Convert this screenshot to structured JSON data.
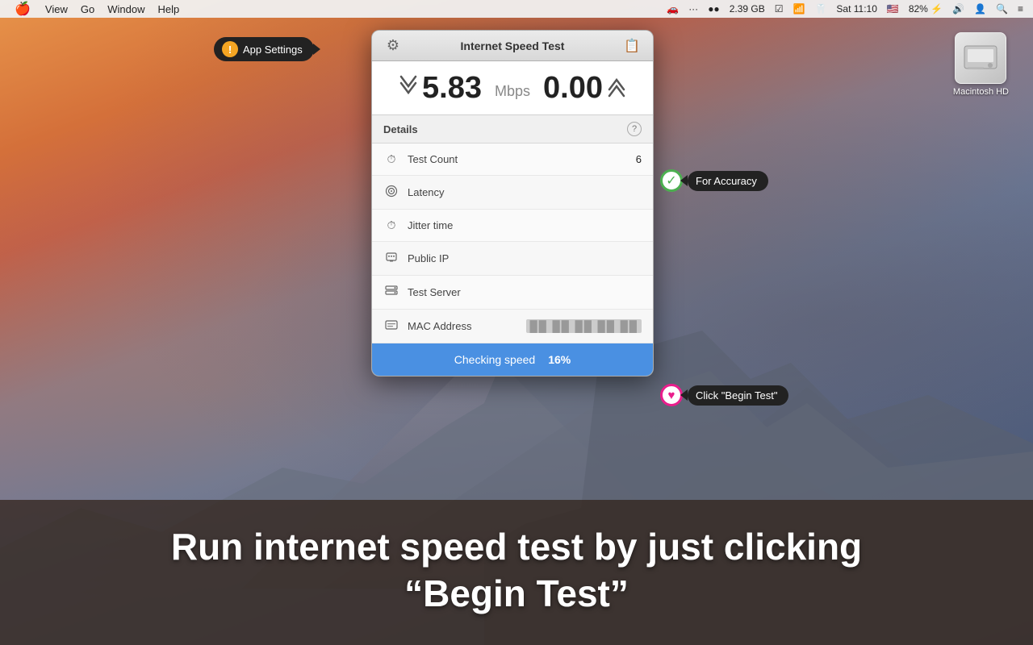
{
  "menubar": {
    "apple": "🍎",
    "items": [
      "View",
      "Go",
      "Window",
      "Help"
    ],
    "right_items": [
      {
        "label": "🚗",
        "name": "car-icon"
      },
      {
        "label": "⋯",
        "name": "dots-icon"
      },
      {
        "label": "●●",
        "name": "battery-dots"
      },
      {
        "label": "2.39 GB",
        "name": "memory-label"
      },
      {
        "label": "☑",
        "name": "clock-icon"
      },
      {
        "label": "WiFi",
        "name": "wifi-icon"
      },
      {
        "label": "BT",
        "name": "bluetooth-icon"
      },
      {
        "label": "Sat 11:10",
        "name": "time-label"
      },
      {
        "label": "🇺🇸",
        "name": "flag-icon"
      },
      {
        "label": "82% ⚡",
        "name": "battery-label"
      },
      {
        "label": "🔊",
        "name": "volume-icon"
      },
      {
        "label": "👤",
        "name": "user-icon"
      },
      {
        "label": "🔍",
        "name": "search-icon"
      },
      {
        "label": "≡",
        "name": "list-icon"
      }
    ]
  },
  "desktop": {
    "hd_icon": {
      "emoji": "💾",
      "label": "Macintosh HD"
    }
  },
  "app_panel": {
    "title": "Internet Speed Test",
    "settings_icon": "⚙",
    "share_icon": "📋",
    "speed": {
      "down_arrows": "≫",
      "down_value": "5.83",
      "unit": "Mbps",
      "up_value": "0.00",
      "up_arrows": "≪"
    },
    "details": {
      "title": "Details",
      "help": "?",
      "rows": [
        {
          "icon": "⏱",
          "label": "Test Count",
          "value": "6",
          "blurred": false,
          "name": "test-count-row"
        },
        {
          "icon": "🔄",
          "label": "Latency",
          "value": "",
          "blurred": false,
          "name": "latency-row"
        },
        {
          "icon": "⏰",
          "label": "Jitter time",
          "value": "",
          "blurred": false,
          "name": "jitter-row"
        },
        {
          "icon": "🌐",
          "label": "Public IP",
          "value": "",
          "blurred": false,
          "name": "public-ip-row"
        },
        {
          "icon": "📶",
          "label": "Test Server",
          "value": "",
          "blurred": false,
          "name": "test-server-row"
        },
        {
          "icon": "💻",
          "label": "MAC Address",
          "value": "██ ██ ██ ██ ██",
          "blurred": true,
          "name": "mac-address-row"
        }
      ]
    },
    "progress": {
      "text": "Checking speed",
      "percent": "16%"
    }
  },
  "callouts": {
    "settings": {
      "label": "App Settings",
      "warning": "!"
    },
    "accuracy": {
      "label": "For Accuracy",
      "check": "✓"
    },
    "begin": {
      "label": "Click \"Begin Test\"",
      "heart": "♥"
    }
  },
  "bottom": {
    "line1": "Run internet speed test by just clicking",
    "line2": "“Begin Test”"
  }
}
